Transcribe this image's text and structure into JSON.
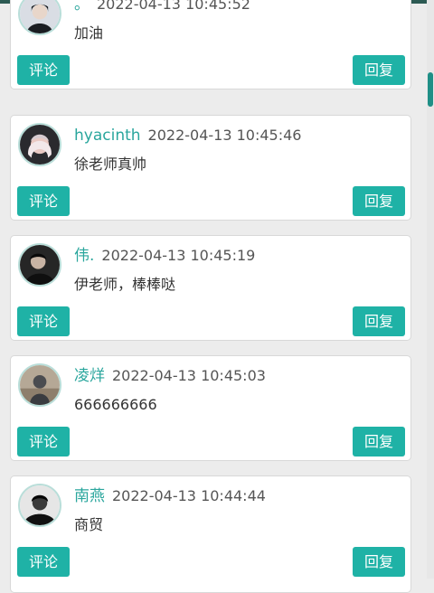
{
  "comments": [
    {
      "username": "。",
      "time": "2022-04-13 10:45:52",
      "content": "加油",
      "comment_label": "评论",
      "reply_label": "回复"
    },
    {
      "username": "hyacinth",
      "time": "2022-04-13 10:45:46",
      "content": "徐老师真帅",
      "comment_label": "评论",
      "reply_label": "回复"
    },
    {
      "username": "伟.",
      "time": "2022-04-13 10:45:19",
      "content": "伊老师，棒棒哒",
      "comment_label": "评论",
      "reply_label": "回复"
    },
    {
      "username": "凌烊",
      "time": "2022-04-13 10:45:03",
      "content": "666666666",
      "comment_label": "评论",
      "reply_label": "回复"
    },
    {
      "username": "南燕",
      "time": "2022-04-13 10:44:44",
      "content": "商贸",
      "comment_label": "评论",
      "reply_label": "回复"
    }
  ],
  "colors": {
    "accent": "#1fb2a6",
    "username": "#2aa69d",
    "topbar": "#2c5a53"
  }
}
